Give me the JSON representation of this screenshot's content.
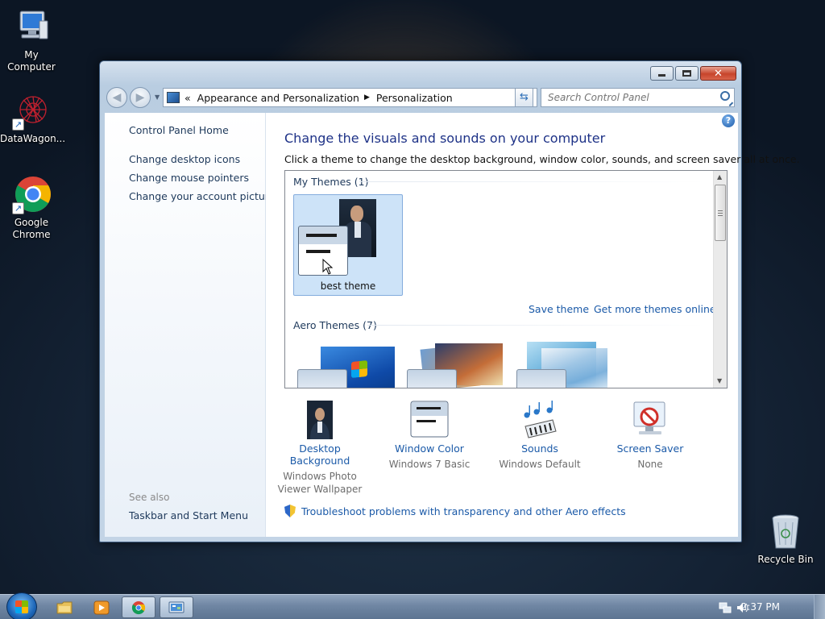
{
  "desktop": {
    "icons": [
      {
        "label": "My Computer"
      },
      {
        "label": "DataWagon..."
      },
      {
        "label": "Google Chrome"
      },
      {
        "label": "Recycle Bin"
      }
    ]
  },
  "window": {
    "breadcrumb": {
      "prefix": "«",
      "items": [
        "Appearance and Personalization",
        "Personalization"
      ]
    },
    "search_placeholder": "Search Control Panel",
    "left_pane": {
      "links": [
        "Control Panel Home",
        "Change desktop icons",
        "Change mouse pointers",
        "Change your account picture"
      ],
      "see_also_label": "See also",
      "see_also_links": [
        "Taskbar and Start Menu"
      ]
    },
    "content": {
      "title": "Change the visuals and sounds on your computer",
      "description": "Click a theme to change the desktop background, window color, sounds, and screen saver all at once.",
      "my_themes_header": "My Themes (1)",
      "selected_theme_name": "best theme",
      "save_theme": "Save theme",
      "get_more_themes": "Get more themes online",
      "aero_themes_header": "Aero Themes (7)",
      "settings": [
        {
          "title": "Desktop Background",
          "sub": "Windows Photo Viewer Wallpaper",
          "icon": "desktop-background-icon"
        },
        {
          "title": "Window Color",
          "sub": "Windows 7 Basic",
          "icon": "window-color-icon"
        },
        {
          "title": "Sounds",
          "sub": "Windows Default",
          "icon": "sounds-icon"
        },
        {
          "title": "Screen Saver",
          "sub": "None",
          "icon": "screen-saver-icon"
        }
      ],
      "troubleshoot": "Troubleshoot problems with transparency and other Aero effects"
    }
  },
  "taskbar": {
    "clock": "2:37 PM",
    "pinned": [
      "explorer-icon",
      "media-player-icon",
      "chrome-icon",
      "control-panel-icon"
    ]
  },
  "colors": {
    "link_blue": "#1b5aa8",
    "title_blue": "#1e3287",
    "selection": "#cde3f8"
  }
}
